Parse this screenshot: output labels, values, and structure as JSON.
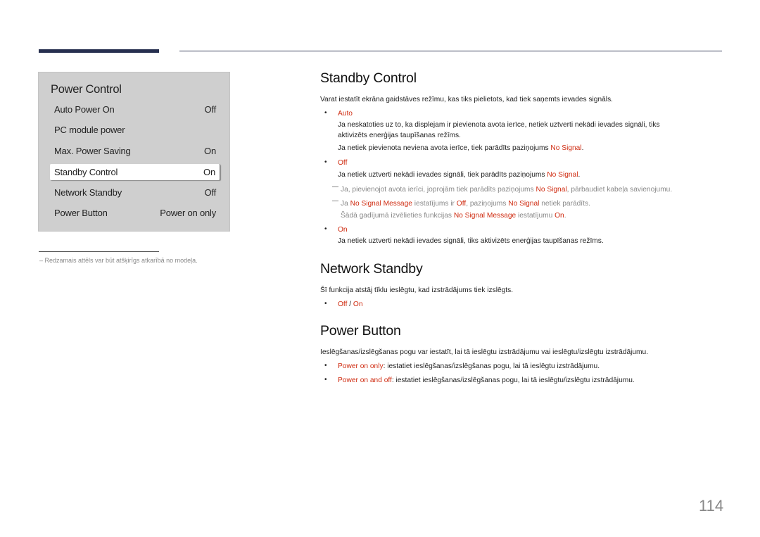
{
  "menu": {
    "title": "Power Control",
    "items": [
      {
        "label": "Auto Power On",
        "value": "Off"
      },
      {
        "label": "PC module power",
        "value": ""
      },
      {
        "label": "Max. Power Saving",
        "value": "On"
      },
      {
        "label": "Standby Control",
        "value": "On",
        "selected": true
      },
      {
        "label": "Network Standby",
        "value": "Off"
      },
      {
        "label": "Power Button",
        "value": "Power on only"
      }
    ]
  },
  "footnote": "– Redzamais attēls var būt atšķirīgs atkarībā no modeļa.",
  "standby": {
    "heading": "Standby Control",
    "intro": "Varat iestatīt ekrāna gaidstāves režīmu, kas tiks pielietots, kad tiek saņemts ievades signāls.",
    "auto_label": "Auto",
    "auto_desc_1": "Ja neskatoties uz to, ka displejam ir pievienota avota ierīce, netiek uztverti nekādi ievades signāli, tiks",
    "auto_desc_2": "aktivizēts enerģijas taupīšanas režīms.",
    "auto_desc_3_pre": "Ja netiek pievienota neviena avota ierīce, tiek parādīts paziņojums ",
    "no_signal": "No Signal",
    "off_label": "Off",
    "off_desc_pre": "Ja netiek uztverti nekādi ievades signāli, tiek parādīts paziņojums ",
    "note1_pre": "Ja, pievienojot avota ierīci, joprojām tiek parādīts paziņojums ",
    "note1_post": ", pārbaudiet kabeļa savienojumu.",
    "note2_a": "Ja ",
    "no_signal_message": "No Signal Message",
    "note2_b": " iestatījums ir ",
    "note2_c": ", paziņojums ",
    "note2_d": " netiek parādīts.",
    "note3_a": "Šādā gadījumā izvēlieties funkcijas ",
    "note3_b": " iestatījumu ",
    "on_label": "On",
    "on_desc": "Ja netiek uztverti nekādi ievades signāli, tiks aktivizēts enerģijas taupīšanas režīms."
  },
  "network": {
    "heading": "Network Standby",
    "intro": "Šī funkcija atstāj tīklu ieslēgtu, kad izstrādājums tiek izslēgts.",
    "opt_off": "Off",
    "sep": " / ",
    "opt_on": "On"
  },
  "power_button": {
    "heading": "Power Button",
    "intro": "Ieslēgšanas/izslēgšanas pogu var iestatīt, lai tā ieslēgtu izstrādājumu vai ieslēgtu/izslēgtu izstrādājumu.",
    "opt1_label": "Power on only",
    "opt1_desc": ": iestatiet ieslēgšanas/izslēgšanas pogu, lai tā ieslēgtu izstrādājumu.",
    "opt2_label": "Power on and off",
    "opt2_desc": ": iestatiet ieslēgšanas/izslēgšanas pogu, lai tā ieslēgtu/izslēgtu izstrādājumu."
  },
  "page_number": "114",
  "colors": {
    "accent": "#cf2b10",
    "header_bar": "#262f4f"
  }
}
